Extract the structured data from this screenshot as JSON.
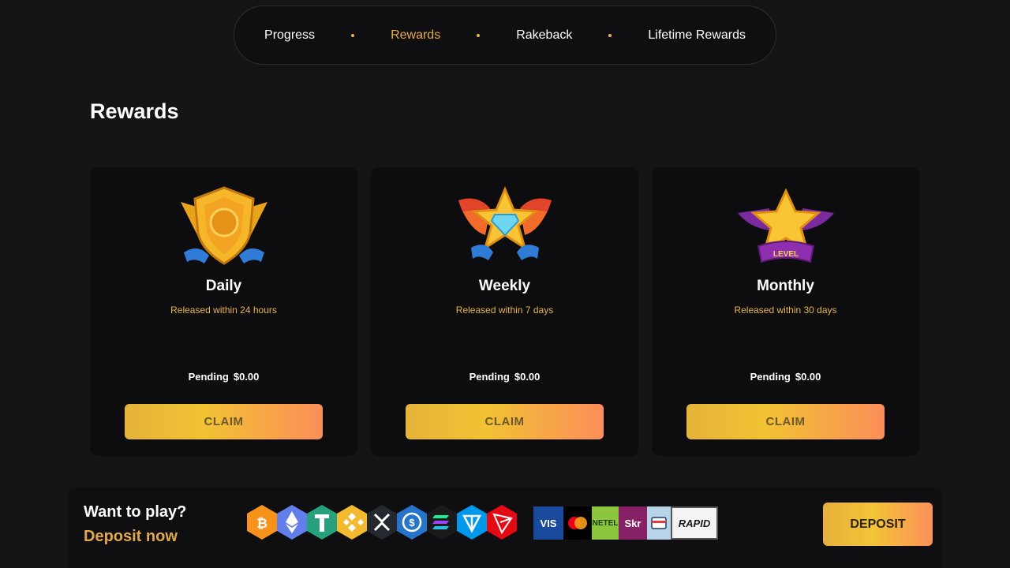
{
  "nav": {
    "items": [
      {
        "label": "Progress",
        "active": false
      },
      {
        "label": "Rewards",
        "active": true
      },
      {
        "label": "Rakeback",
        "active": false
      },
      {
        "label": "Lifetime Rewards",
        "active": false
      }
    ],
    "active_color": "#e9a94a"
  },
  "section_title": "Rewards",
  "cards": [
    {
      "title": "Daily",
      "subtitle": "Released within 24 hours",
      "pending_label": "Pending",
      "pending_value": "$0.00",
      "button": "CLAIM",
      "badge_icon": "gold-shield-badge-icon"
    },
    {
      "title": "Weekly",
      "subtitle": "Released within 7 days",
      "pending_label": "Pending",
      "pending_value": "$0.00",
      "button": "CLAIM",
      "badge_icon": "winged-star-diamond-badge-icon"
    },
    {
      "title": "Monthly",
      "subtitle": "Released within 30 days",
      "pending_label": "Pending",
      "pending_value": "$0.00",
      "button": "CLAIM",
      "badge_icon": "level-star-badge-icon",
      "badge_text": "LEVEL"
    }
  ],
  "footer": {
    "heading": "Want to play?",
    "link": "Deposit now",
    "deposit_button": "DEPOSIT",
    "coins": [
      {
        "name": "bitcoin-icon",
        "color": "#f7931a"
      },
      {
        "name": "ethereum-icon",
        "color": "#627eea"
      },
      {
        "name": "tether-icon",
        "color": "#26a17b"
      },
      {
        "name": "binance-coin-icon",
        "color": "#f3ba2f"
      },
      {
        "name": "xrp-icon",
        "color": "#23292f"
      },
      {
        "name": "usdc-icon",
        "color": "#2775ca"
      },
      {
        "name": "solana-icon",
        "color": "#1a1a1a"
      },
      {
        "name": "toncoin-icon",
        "color": "#0098ea"
      },
      {
        "name": "tron-icon",
        "color": "#e50914"
      }
    ],
    "payments": [
      {
        "name": "visa-logo-icon",
        "text": "VIS",
        "bg": "#1a4a9c",
        "fg": "#ffffff"
      },
      {
        "name": "mastercard-logo-icon",
        "text": "",
        "bg": "#000000",
        "fg": "#ffffff"
      },
      {
        "name": "neteller-logo-icon",
        "text": "NETEL",
        "bg": "#8cc63f",
        "fg": "#1d3d0c"
      },
      {
        "name": "skrill-logo-icon",
        "text": "Skr",
        "bg": "#862165",
        "fg": "#ffffff"
      },
      {
        "name": "paysafecard-logo-icon",
        "text": "",
        "bg": "#b8d4e8",
        "fg": "#1a3c6e"
      },
      {
        "name": "rapid-transfer-logo-icon",
        "text": "RAPID",
        "bg": "#f4f4f4",
        "fg": "#1a1a1a"
      }
    ]
  }
}
